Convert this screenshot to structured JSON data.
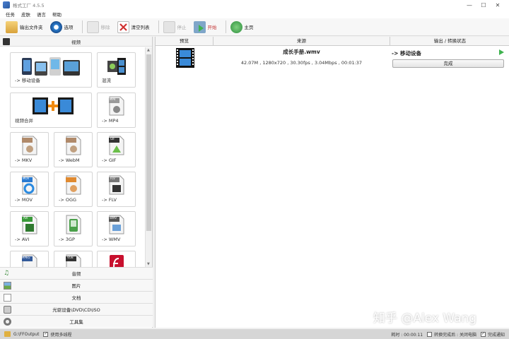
{
  "window": {
    "title": "格式工厂 4.5.5"
  },
  "menu": {
    "items": [
      "任务",
      "皮肤",
      "语言",
      "帮助"
    ]
  },
  "toolbar": {
    "output_folder": "输出文件夹",
    "options": "选项",
    "remove": "移除",
    "clear_list": "清空列表",
    "stop": "停止",
    "start": "开始",
    "home": "主页"
  },
  "left": {
    "video_header": "视频",
    "tiles": [
      "-> 移动设备",
      "混流",
      "视频合并",
      "-> MP4",
      "-> MKV",
      "-> WebM",
      "-> GIF",
      "-> MOV",
      "-> OGG",
      "-> FLV",
      "-> AVI",
      "-> 3GP",
      "-> WMV"
    ],
    "tile_badges": [
      "MP4",
      "GIF",
      "MOV",
      "FLV",
      "AVI",
      "WMV",
      "MPEG",
      "VOB"
    ],
    "categories": [
      "音频",
      "图片",
      "文档",
      "光驱设备\\DVD\\CD\\ISO",
      "工具集"
    ]
  },
  "table": {
    "headers": {
      "preview": "预览",
      "source": "来源",
      "output": "输出 / 转换状态"
    },
    "rows": [
      {
        "name": "成长手册.wmv",
        "info": "42.07M , 1280x720 , 30.30fps , 3.04Mbps , 00:01:37",
        "target": "-> 移动设备",
        "status": "完成"
      }
    ]
  },
  "statusbar": {
    "path": "G:\\FFOutput",
    "multithread": "使用多线程",
    "elapsed": "耗时 : 00:00:11",
    "after_convert_label": "转换完成后 : 关闭电脑",
    "notify": "完成通知"
  },
  "watermark": "知乎 @Alex Wang",
  "colors": {
    "accent_green": "#3fb34f",
    "statusbar": "#d6d6d6"
  }
}
